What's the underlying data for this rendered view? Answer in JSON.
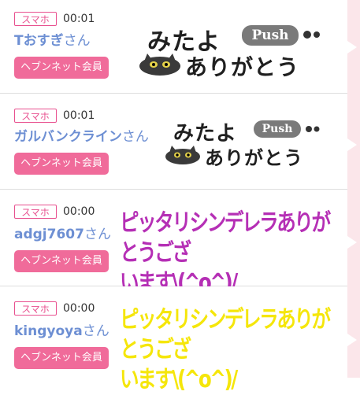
{
  "rows": [
    {
      "device_badge": "スマホ",
      "time": "00:01",
      "user_name": "Tおすぎ",
      "honorific": "さん",
      "member_button": "ヘブンネット会員",
      "stamp": {
        "line1": "みたよ",
        "push": "Push",
        "line2": "ありがとう"
      }
    },
    {
      "device_badge": "スマホ",
      "time": "00:01",
      "user_name": "ガルバンクライン",
      "honorific": "さん",
      "member_button": "ヘブンネット会員",
      "stamp": {
        "line1": "みたよ",
        "push": "Push",
        "line2": "ありがとう"
      }
    },
    {
      "device_badge": "スマホ",
      "time": "00:00",
      "user_name": "adgj7607",
      "honorific": "さん",
      "member_button": "ヘブンネット会員",
      "message": "ピッタリシンデレラありがとうござ\nいます\\(^o^)/",
      "message_color": "#b52fb5"
    },
    {
      "device_badge": "スマホ",
      "time": "00:00",
      "user_name": "kingyoya",
      "honorific": "さん",
      "member_button": "ヘブンネット会員",
      "message": "ピッタリシンデレラありがとうござ\nいます\\(^o^)/",
      "message_color": "#f5e60a"
    }
  ],
  "colors": {
    "badge_border": "#e8508f",
    "name": "#6d8fd3",
    "member_button_bg": "#f06b9a",
    "scrollbar_bg": "#fbe6ea"
  }
}
